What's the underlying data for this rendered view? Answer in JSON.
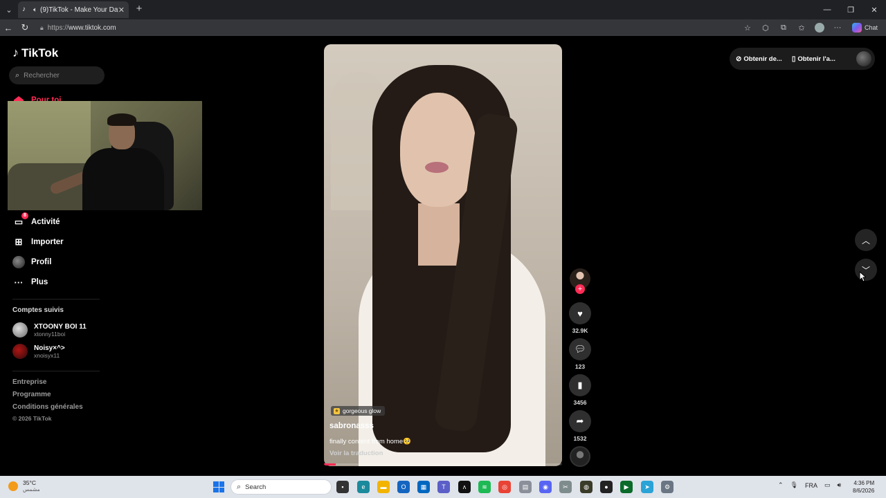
{
  "browser": {
    "tab_title": "(9)TikTok - Make Your Day",
    "url_prefix": "https://",
    "url_host": "www.tiktok.com",
    "chat_label": "Chat"
  },
  "sidebar": {
    "logo": "TikTok",
    "search_placeholder": "Rechercher",
    "nav": {
      "for_you": "Pour toi",
      "activity": "Activité",
      "activity_badge": "8",
      "upload": "Importer",
      "profile": "Profil",
      "more": "Plus"
    },
    "following_header": "Comptes suivis",
    "following": [
      {
        "name": "XTOONY BOI 11",
        "handle": "xtonny11boi"
      },
      {
        "name": "Noisy×^>",
        "handle": "xnoisyx11"
      }
    ],
    "footer": [
      "Entreprise",
      "Programme",
      "Conditions générales"
    ],
    "copyright": "© 2026 TikTok"
  },
  "video": {
    "tag": "gorgeous glow",
    "username": "sabronasss",
    "caption": "finally content from home🥺",
    "translate": "Voir la traduction",
    "progress": 0.05
  },
  "actions": {
    "likes": "32.9K",
    "comments": "123",
    "saves": "3456",
    "shares": "1532"
  },
  "top_right": {
    "coins": "Obtenir de...",
    "app": "Obtenir l'a..."
  },
  "taskbar": {
    "temp": "35°C",
    "weather_desc": "مشمس",
    "search": "Search",
    "lang": "FRA",
    "time": "4:36 PM",
    "date": "8/6/2026"
  },
  "colors": {
    "accent": "#fe2c55",
    "page_bg": "#000000",
    "taskbar_bg": "#dfe3ea"
  }
}
